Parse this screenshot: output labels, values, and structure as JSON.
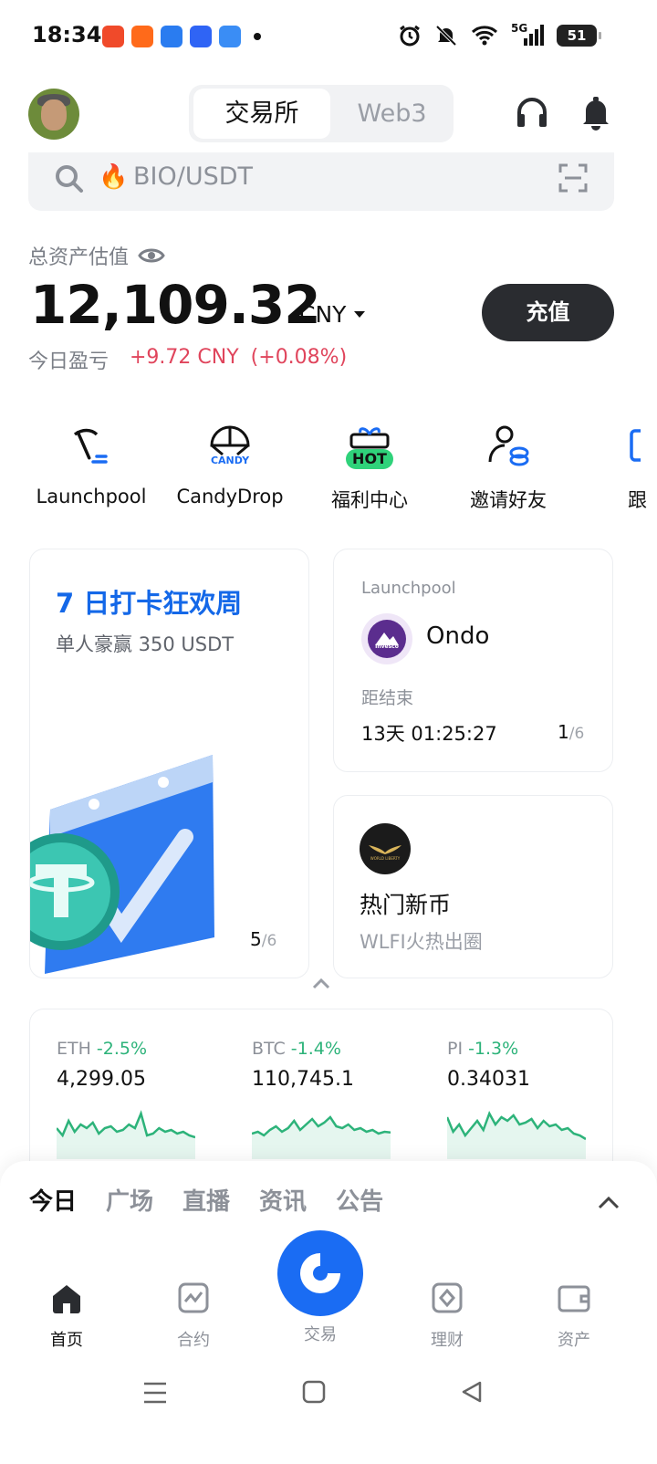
{
  "status_bar": {
    "time": "18:34",
    "network": "5G",
    "battery": "51",
    "app_icon_colors": [
      "#f04a2a",
      "#ff6a1a",
      "#2a7cf0",
      "#2f64f5",
      "#3a8df5"
    ]
  },
  "header": {
    "segments": [
      "交易所",
      "Web3"
    ],
    "active_segment": "交易所",
    "icons": [
      "avatar",
      "headset-icon",
      "bell-icon"
    ]
  },
  "search": {
    "placeholder": "BIO/USDT",
    "prefix_icon": "fire-icon"
  },
  "balance": {
    "label": "总资产估值",
    "value": "12,109.32",
    "unit": "CNY",
    "deposit_label": "充值",
    "pnl_label": "今日盈亏",
    "pnl_value": "+9.72 CNY",
    "pnl_percent": "(+0.08%)"
  },
  "quick_actions": [
    {
      "label": "Launchpool",
      "icon": "pickaxe-icon"
    },
    {
      "label": "CandyDrop",
      "icon": "parachute-icon",
      "icon_text": "CANDY"
    },
    {
      "label": "福利中心",
      "icon": "gift-icon",
      "badge": "HOT"
    },
    {
      "label": "邀请好友",
      "icon": "invite-user-icon"
    },
    {
      "label": "跟",
      "icon": "copy-trade-icon"
    }
  ],
  "promo_card": {
    "title": "7 日打卡狂欢周",
    "subtitle": "单人豪赢 350 USDT",
    "page_current": "5",
    "page_total": "/6"
  },
  "launchpool_card": {
    "label": "Launchpool",
    "token": "Ondo",
    "logo_text": "Invesco",
    "end_label": "距结束",
    "countdown": "13天 01:25:27",
    "page_current": "1",
    "page_total": "/6"
  },
  "new_coin_card": {
    "title": "热门新币",
    "subtitle": "WLFI火热出圈",
    "logo_text": "WORLD LIBERTY"
  },
  "tickers": [
    {
      "name": "ETH",
      "change": "-2.5%",
      "price": "4,299.05",
      "spark": [
        0.5,
        0.3,
        0.7,
        0.4,
        0.6,
        0.5,
        0.65,
        0.35,
        0.5,
        0.55,
        0.4,
        0.45,
        0.6,
        0.5,
        0.9,
        0.3,
        0.35,
        0.5,
        0.4,
        0.45,
        0.35,
        0.4,
        0.3,
        0.25
      ]
    },
    {
      "name": "BTC",
      "change": "-1.4%",
      "price": "110,745.1",
      "spark": [
        0.35,
        0.4,
        0.3,
        0.45,
        0.55,
        0.4,
        0.5,
        0.7,
        0.45,
        0.6,
        0.75,
        0.55,
        0.65,
        0.8,
        0.55,
        0.5,
        0.6,
        0.45,
        0.5,
        0.4,
        0.45,
        0.35,
        0.4,
        0.38
      ]
    },
    {
      "name": "PI",
      "change": "-1.3%",
      "price": "0.34031",
      "spark": [
        0.8,
        0.4,
        0.6,
        0.3,
        0.5,
        0.7,
        0.45,
        0.9,
        0.6,
        0.8,
        0.7,
        0.85,
        0.6,
        0.65,
        0.75,
        0.5,
        0.7,
        0.55,
        0.6,
        0.45,
        0.5,
        0.35,
        0.3,
        0.2
      ]
    }
  ],
  "feed_tabs": [
    "今日",
    "广场",
    "直播",
    "资讯",
    "公告"
  ],
  "bottom_nav": [
    {
      "label": "首页",
      "icon": "home-icon"
    },
    {
      "label": "合约",
      "icon": "futures-icon"
    },
    {
      "label": "交易",
      "icon": "trade-icon"
    },
    {
      "label": "理财",
      "icon": "earn-icon"
    },
    {
      "label": "资产",
      "icon": "wallet-icon"
    }
  ],
  "colors": {
    "accent": "#1a6cf3",
    "positive": "#2db37a",
    "negative": "#e0455c",
    "promo_title": "#1468e8",
    "hot_badge": "#2fd27a"
  }
}
